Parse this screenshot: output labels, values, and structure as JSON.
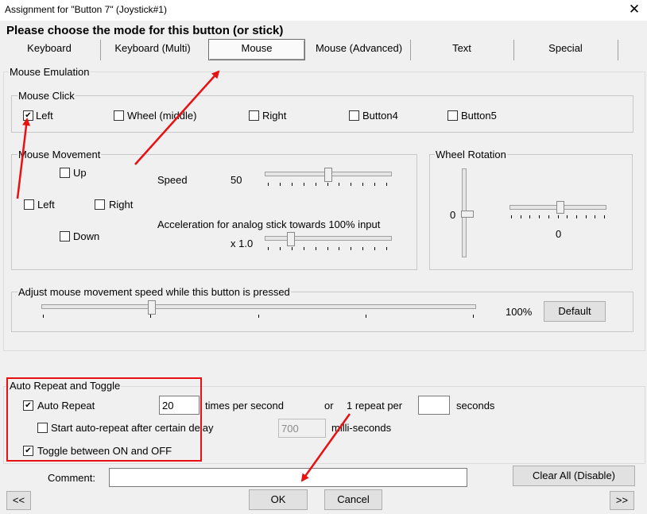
{
  "window": {
    "title": "Assignment for \"Button 7\" (Joystick#1)",
    "close_icon": "close-icon"
  },
  "heading": "Please choose the mode for this button (or stick)",
  "tabs": {
    "keyboard": "Keyboard",
    "keyboard_multi": "Keyboard (Multi)",
    "mouse": "Mouse",
    "mouse_advanced": "Mouse (Advanced)",
    "text": "Text",
    "special": "Special",
    "selected": "Mouse"
  },
  "mouse_emulation": {
    "title": "Mouse Emulation",
    "click": {
      "title": "Mouse Click",
      "left": "Left",
      "wheel": "Wheel (middle)",
      "right": "Right",
      "button4": "Button4",
      "button5": "Button5",
      "left_checked": true
    },
    "movement": {
      "title": "Mouse Movement",
      "up": "Up",
      "left": "Left",
      "right": "Right",
      "down": "Down",
      "speed_label": "Speed",
      "speed_value": "50",
      "speed_level": 0.5,
      "accel_label": "Acceleration for analog stick towards 100% input",
      "accel_value": "x 1.0",
      "accel_level": 0.2
    },
    "wheel": {
      "title": "Wheel Rotation",
      "vertical_value": "0",
      "horizontal_value": "0"
    },
    "adjust": {
      "title": "Adjust mouse movement speed while this button is pressed",
      "percent": "100%",
      "default_button": "Default",
      "level": 0.25
    }
  },
  "auto_repeat": {
    "title": "Auto Repeat and Toggle",
    "auto_repeat_label": "Auto Repeat",
    "auto_repeat_checked": true,
    "times_value": "20",
    "times_label": "times per second",
    "or_label": "or",
    "repeat_per_label": "1 repeat per",
    "seconds_value": "",
    "seconds_label": "seconds",
    "start_delay_label": "Start auto-repeat after certain delay",
    "start_delay_checked": false,
    "delay_value": "700",
    "delay_label": "milli-seconds",
    "toggle_label": "Toggle between ON and OFF",
    "toggle_checked": true
  },
  "comment": {
    "label": "Comment:",
    "value": ""
  },
  "buttons": {
    "clear_all": "Clear All (Disable)",
    "prev": "<<",
    "ok": "OK",
    "cancel": "Cancel",
    "next": ">>"
  },
  "colors": {
    "annotation_red": "#e81010",
    "background": "#f0f0f0"
  }
}
